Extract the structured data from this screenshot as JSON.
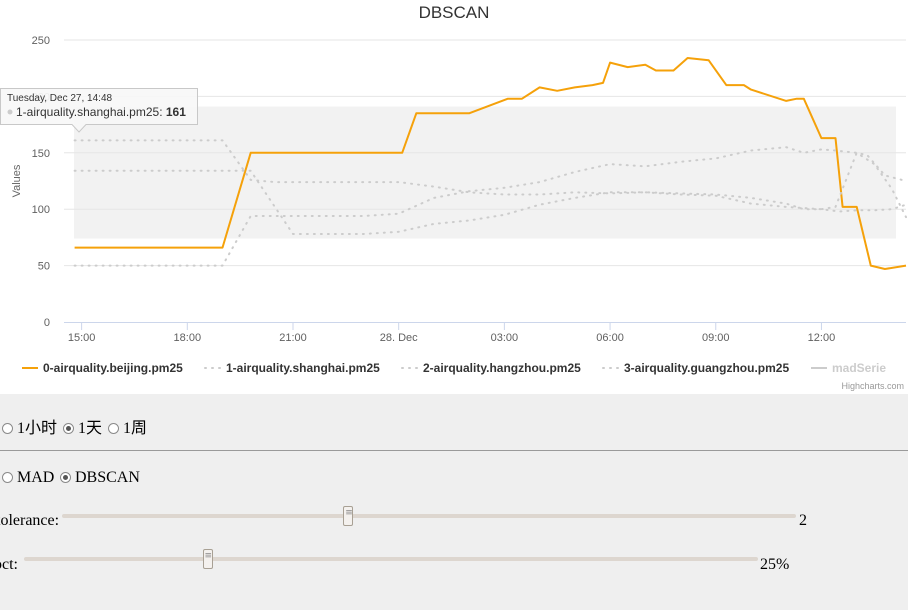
{
  "chart_data": {
    "type": "line",
    "title": "DBSCAN",
    "ylabel": "Values",
    "ylim": [
      0,
      250
    ],
    "y_ticks": [
      0,
      50,
      100,
      150,
      200,
      250
    ],
    "x_ticks": [
      "15:00",
      "18:00",
      "21:00",
      "28. Dec",
      "03:00",
      "06:00",
      "09:00",
      "12:00"
    ],
    "x_tick_hours": [
      15,
      18,
      21,
      24,
      27,
      30,
      33,
      36
    ],
    "xlim_hours": [
      14.5,
      38.4
    ],
    "band": {
      "from": 74,
      "to": 191
    },
    "series": [
      {
        "name": "0-airquality.beijing.pm25",
        "color": "#f5a10a",
        "style": "solid",
        "x": [
          14.8,
          19,
          19.8,
          21,
          22,
          23,
          24.1,
          24.5,
          25,
          26,
          27.1,
          27.5,
          28,
          28.5,
          29,
          29.5,
          29.8,
          30,
          30.5,
          31,
          31.3,
          31.8,
          32.2,
          32.8,
          33.3,
          33.8,
          34,
          35,
          35.3,
          35.5,
          36,
          36.4,
          36.6,
          37,
          37.4,
          37.8,
          38.4
        ],
        "y": [
          66,
          66,
          150,
          150,
          150,
          150,
          150,
          185,
          185,
          185,
          198,
          198,
          208,
          205,
          208,
          210,
          212,
          230,
          226,
          228,
          223,
          223,
          234,
          232,
          210,
          210,
          206,
          196,
          198,
          198,
          163,
          163,
          102,
          102,
          50,
          47,
          50
        ]
      },
      {
        "name": "1-airquality.shanghai.pm25",
        "color": "#cccccc",
        "style": "dotted",
        "x": [
          14.8,
          19,
          19.8,
          20.5,
          21,
          22,
          23,
          24,
          25,
          26,
          27,
          28,
          29,
          30,
          31,
          32,
          33,
          34,
          35,
          35.5,
          36,
          36.4,
          37,
          37.3,
          37.8,
          38.4
        ],
        "y": [
          161,
          161,
          126,
          124,
          124,
          124,
          124,
          124,
          120,
          115,
          113,
          113,
          115,
          114,
          115,
          114,
          113,
          110,
          105,
          100,
          100,
          102,
          150,
          148,
          130,
          125
        ]
      },
      {
        "name": "2-airquality.hangzhou.pm25",
        "color": "#cccccc",
        "style": "dotted",
        "x": [
          14.8,
          19,
          19.8,
          21,
          22,
          23,
          24,
          25,
          26,
          27,
          28,
          29,
          30,
          31,
          32,
          33,
          34,
          35,
          36,
          36.5,
          37,
          37.5,
          38,
          38.4
        ],
        "y": [
          134,
          134,
          134,
          78,
          78,
          78,
          80,
          87,
          90,
          95,
          104,
          110,
          115,
          115,
          113,
          112,
          105,
          102,
          100,
          98,
          99,
          99,
          100,
          104
        ]
      },
      {
        "name": "3-airquality.guangzhou.pm25",
        "color": "#cccccc",
        "style": "dotted",
        "x": [
          14.8,
          19,
          19.8,
          21,
          22,
          23,
          24,
          25,
          26,
          27,
          28,
          29,
          30,
          31,
          32,
          33,
          34,
          35,
          35.5,
          36,
          36.4,
          37,
          37.5,
          38,
          38.4
        ],
        "y": [
          50,
          50,
          94,
          94,
          94,
          94,
          96,
          110,
          116,
          119,
          124,
          133,
          140,
          138,
          142,
          145,
          152,
          155,
          150,
          153,
          152,
          150,
          140,
          118,
          93
        ]
      },
      {
        "name": "madSerie",
        "color": "#cccccc",
        "style": "hidden",
        "x": [],
        "y": []
      }
    ],
    "tooltip": {
      "date": "Tuesday, Dec 27, 14:48",
      "series": "1-airquality.shanghai.pm25",
      "value": "161"
    },
    "credit": "Highcharts.com"
  },
  "controls": {
    "interval": {
      "options": [
        "1小时",
        "1天",
        "1周"
      ],
      "selected": "1天"
    },
    "algorithm": {
      "options": [
        "MAD",
        "DBSCAN"
      ],
      "selected": "DBSCAN"
    },
    "tolerance": {
      "label": "tolerance:",
      "value": "2",
      "fraction": 0.39
    },
    "pct": {
      "label": "pct:",
      "value": "25%",
      "fraction": 0.25
    }
  }
}
